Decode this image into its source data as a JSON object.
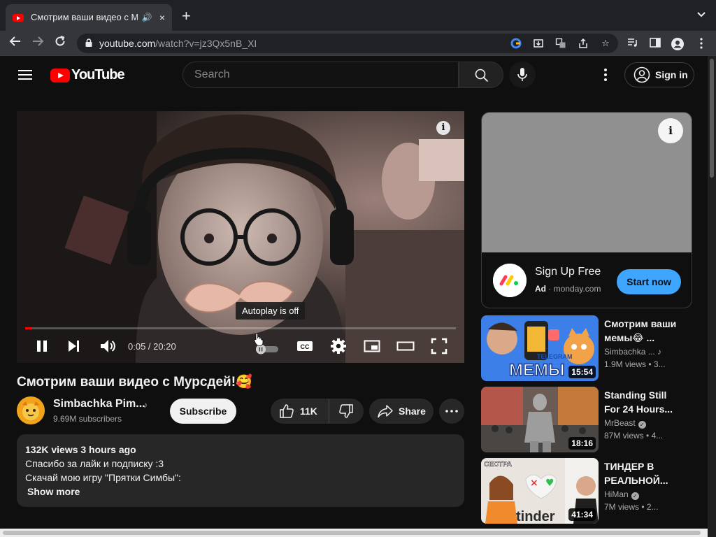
{
  "browser": {
    "tab_title": "Смотрим ваши видео с Мурсдей!🥰",
    "tab_close": "×",
    "new_tab": "+",
    "url_host": "youtube.com",
    "url_path": "/watch?v=jz3Qx5nB_XI"
  },
  "header": {
    "logo_text": "YouTube",
    "search_placeholder": "Search",
    "signin_label": "Sign in"
  },
  "player": {
    "tooltip": "Autoplay is off",
    "current_time": "0:05",
    "duration": "20:20",
    "time_display": "0:05 / 20:20",
    "progress_fraction": 0.004,
    "info_glyph": "i",
    "cc_label": "CC",
    "autoplay_on": false
  },
  "video": {
    "title": "Смотрим ваши видео с Мурсдей!🥰",
    "channel_name": "Simbachka Pim...",
    "channel_note": "♪",
    "subscribers": "9.69M subscribers",
    "subscribe_label": "Subscribe",
    "likes": "11K",
    "share_label": "Share",
    "description": {
      "meta": "132K views  3 hours ago",
      "line1": "Спасибо за лайк и подписку :3",
      "line2": "Скачай мою игру \"Прятки Симбы\":",
      "show_more": "Show more"
    }
  },
  "ad": {
    "info_glyph": "i",
    "title": "Sign Up Free",
    "badge": "Ad",
    "separator": " · ",
    "domain": "monday.com",
    "cta": "Start now"
  },
  "recommendations": [
    {
      "title": "Смотрим ваши мемы😂 ...",
      "channel": "Simbachka ...",
      "channel_mark": "♪",
      "views": "1.9M views",
      "age": "• 3...",
      "duration": "15:54",
      "thumb_text": "МЕМЫ",
      "thumb_badge": "TELEGRAM"
    },
    {
      "title": "Standing Still For 24 Hours...",
      "channel": "MrBeast",
      "channel_mark": "✓",
      "views": "87M views",
      "age": "• 4...",
      "duration": "18:16"
    },
    {
      "title": "ТИНДЕР В РЕАЛЬНОЙ...",
      "channel": "HiMan",
      "channel_mark": "✓",
      "views": "7M views",
      "age": "• 2...",
      "duration": "41:34",
      "thumb_text": "СЕСТРА",
      "thumb_badge": "tinder"
    }
  ],
  "colors": {
    "background": "#0f0f0f",
    "brand_red": "#ff0000",
    "cta_blue": "#3ea6ff",
    "pill": "#272727"
  }
}
